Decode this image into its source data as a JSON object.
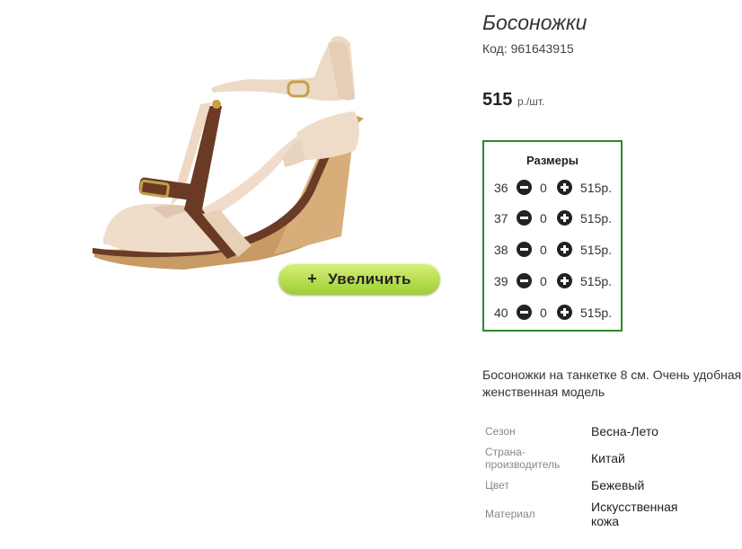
{
  "product": {
    "title": "Босоножки",
    "code_label": "Код: 961643915",
    "price": "515",
    "price_unit": "р./шт.",
    "zoom_label": "Увеличить",
    "zoom_plus": "+"
  },
  "sizes": {
    "title": "Размеры",
    "rows": [
      {
        "size": "36",
        "qty": "0",
        "price": "515р."
      },
      {
        "size": "37",
        "qty": "0",
        "price": "515р."
      },
      {
        "size": "38",
        "qty": "0",
        "price": "515р."
      },
      {
        "size": "39",
        "qty": "0",
        "price": "515р."
      },
      {
        "size": "40",
        "qty": "0",
        "price": "515р."
      }
    ]
  },
  "description": {
    "line1": "Босоножки на танкетке 8 см. Очень удобная",
    "line2": "женственная модель"
  },
  "specs": [
    {
      "label": "Сезон",
      "value": "Весна-Лето"
    },
    {
      "label": "Страна-производитель",
      "label_line1": "Страна-",
      "label_line2": "производитель",
      "value": "Китай"
    },
    {
      "label": "Цвет",
      "value": "Бежевый"
    },
    {
      "label": "Материал",
      "value_line1": "Искусственная",
      "value_line2": "кожа"
    }
  ],
  "colors": {
    "accent_border": "#2b8a2b",
    "button_green": "#9ccf33"
  }
}
